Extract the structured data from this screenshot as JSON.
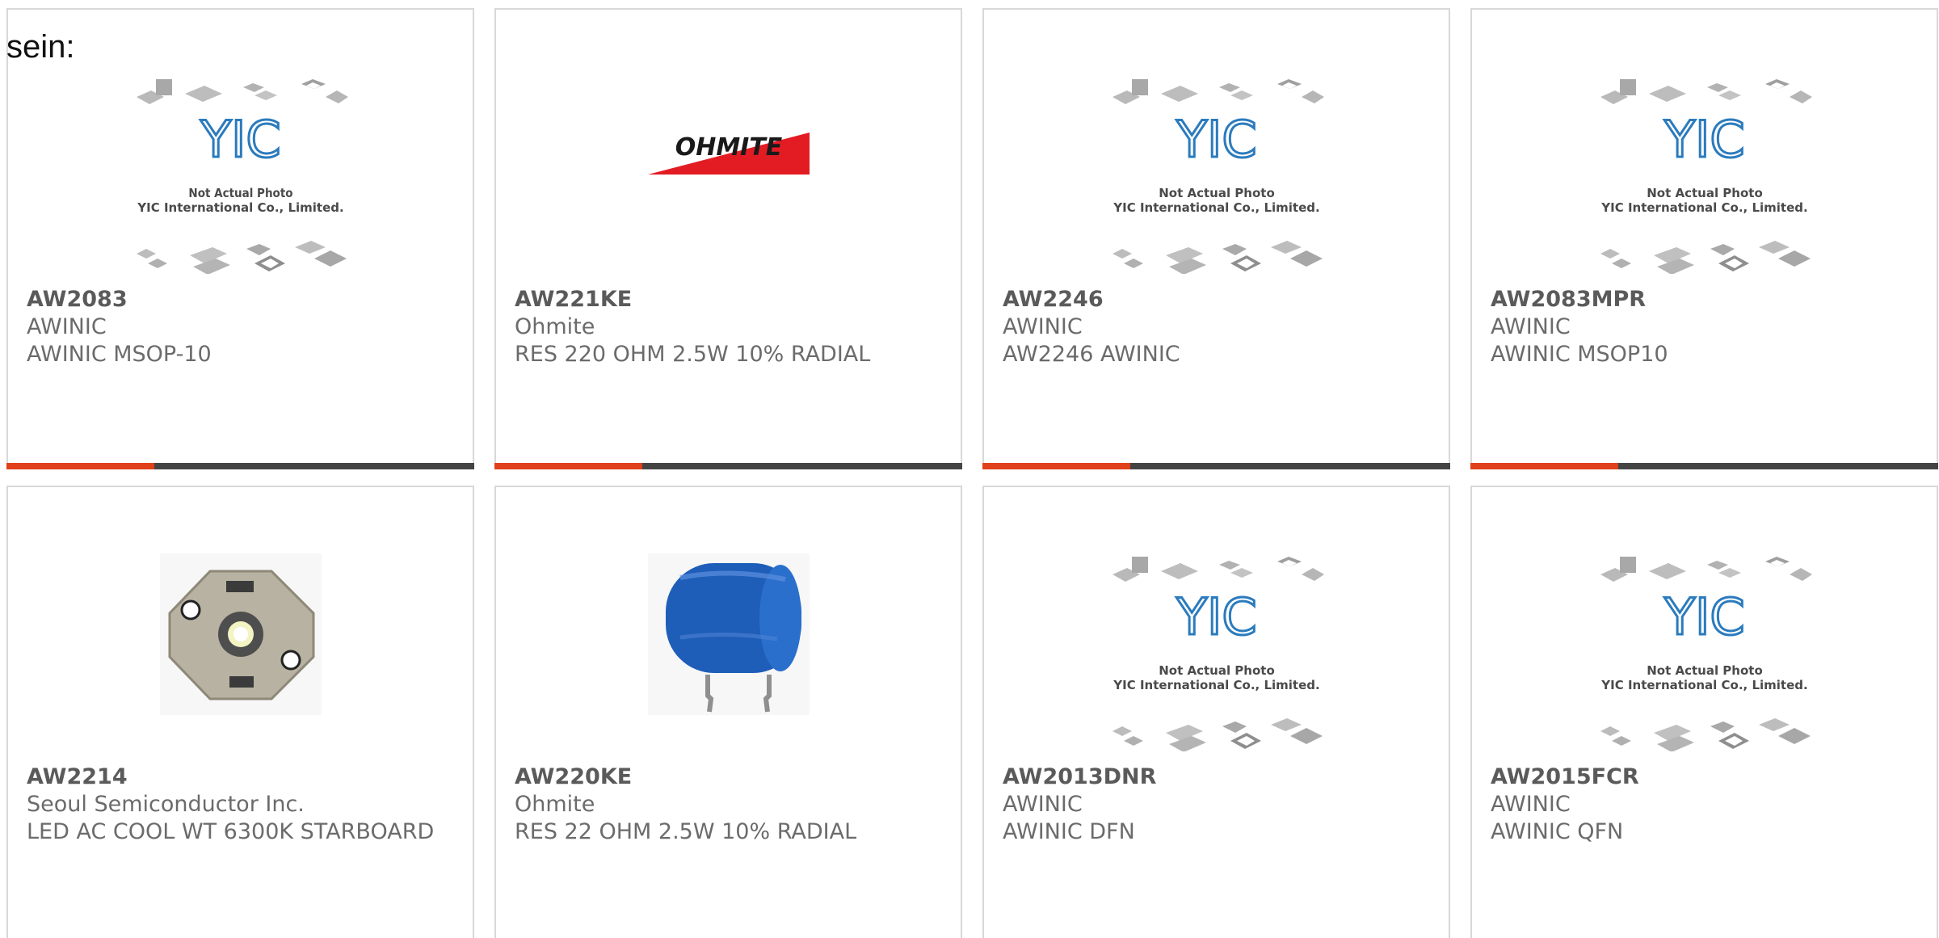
{
  "intro_text": "sein:",
  "placeholder": {
    "brand": "YIC",
    "line1": "Not Actual Photo",
    "line2": "YIC International Co., Limited."
  },
  "ohmite_logo_text": "OHMITE",
  "products": [
    {
      "part": "AW2083",
      "manufacturer": "AWINIC",
      "description": "AWINIC MSOP-10",
      "image": "placeholder"
    },
    {
      "part": "AW221KE",
      "manufacturer": "Ohmite",
      "description": "RES 220 OHM 2.5W 10% RADIAL",
      "image": "ohmite-logo"
    },
    {
      "part": "AW2246",
      "manufacturer": "AWINIC",
      "description": "AW2246 AWINIC",
      "image": "placeholder"
    },
    {
      "part": "AW2083MPR",
      "manufacturer": "AWINIC",
      "description": "AWINIC MSOP10",
      "image": "placeholder"
    },
    {
      "part": "AW2214",
      "manufacturer": "Seoul Semiconductor Inc.",
      "description": "LED AC COOL WT 6300K STARBOARD",
      "image": "led-board"
    },
    {
      "part": "AW220KE",
      "manufacturer": "Ohmite",
      "description": "RES 22 OHM 2.5W 10% RADIAL",
      "image": "capacitor"
    },
    {
      "part": "AW2013DNR",
      "manufacturer": "AWINIC",
      "description": "AWINIC DFN",
      "image": "placeholder"
    },
    {
      "part": "AW2015FCR",
      "manufacturer": "AWINIC",
      "description": "AWINIC QFN",
      "image": "placeholder"
    }
  ],
  "colors": {
    "accent": "#e0401a",
    "bar_dark": "#444444",
    "text": "#6b6b6b",
    "yic_blue": "#2b7bbd",
    "ohmite_red": "#e31c24"
  }
}
